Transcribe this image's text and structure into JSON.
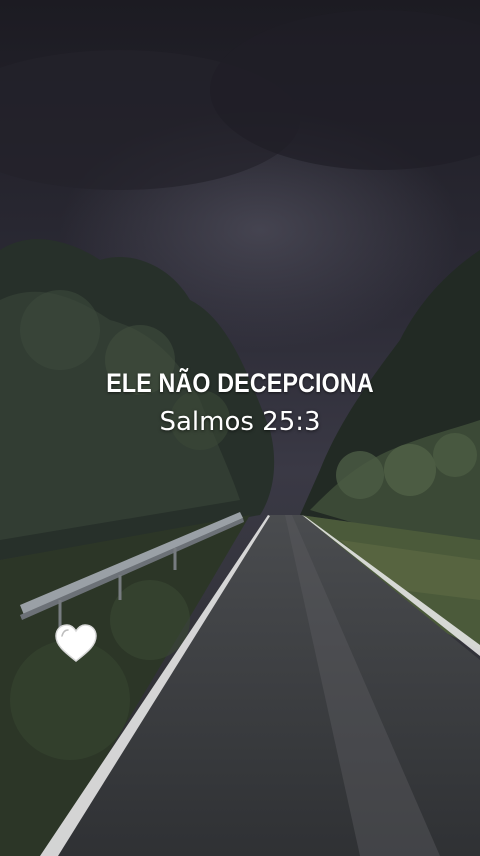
{
  "story": {
    "headline": "ELE NÃO DECEPCIONA",
    "reference": "Salmos 25:3"
  },
  "actions": {
    "like_icon": "heart-icon"
  },
  "colors": {
    "sky": "#2b2a35",
    "foliage": "#2f3a2c",
    "road": "#3c3e41",
    "text": "#ffffff"
  }
}
